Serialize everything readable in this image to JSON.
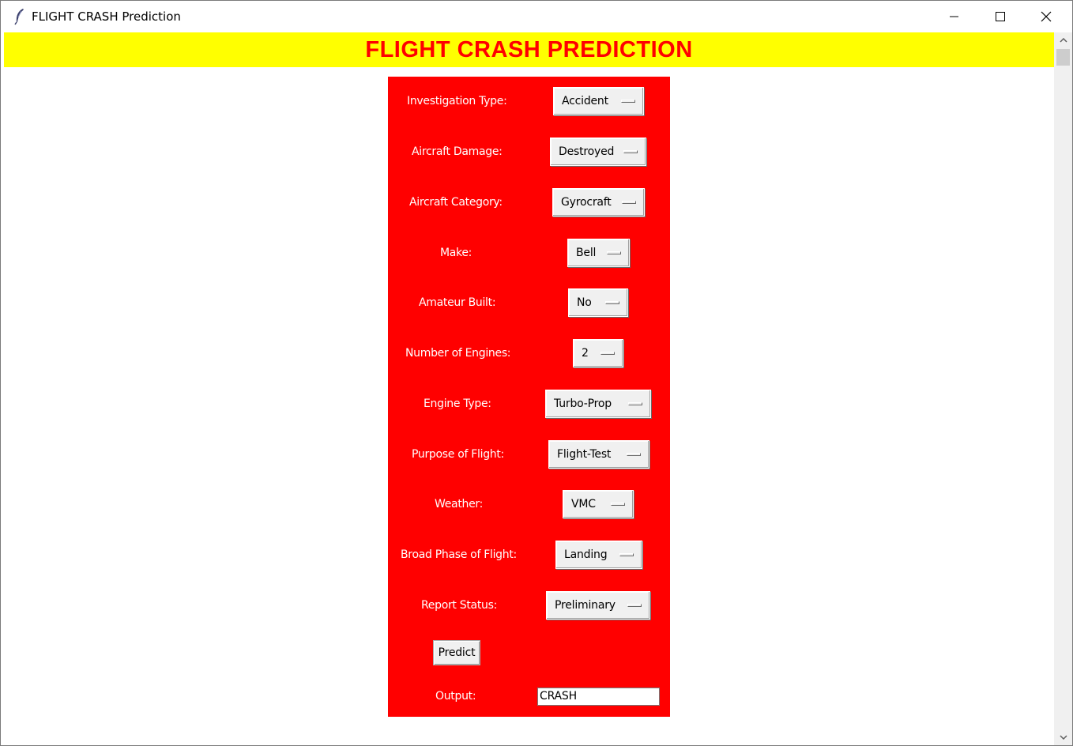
{
  "window": {
    "title": "FLIGHT CRASH Prediction"
  },
  "banner": {
    "title": "FLIGHT CRASH PREDICTION",
    "background_color": "#ffff00",
    "text_color": "#ff0000"
  },
  "panel": {
    "background_color": "#ff0000"
  },
  "fields": [
    {
      "label": "Investigation Type:",
      "value": "Accident"
    },
    {
      "label": "Aircraft Damage:",
      "value": "Destroyed"
    },
    {
      "label": "Aircraft Category:",
      "value": "Gyrocraft"
    },
    {
      "label": "Make:",
      "value": "Bell"
    },
    {
      "label": "Amateur Built:",
      "value": "No"
    },
    {
      "label": "Number of Engines:",
      "value": "2"
    },
    {
      "label": "Engine Type:",
      "value": "Turbo-Prop"
    },
    {
      "label": "Purpose of Flight:",
      "value": "Flight-Test"
    },
    {
      "label": "Weather:",
      "value": "VMC"
    },
    {
      "label": "Broad Phase of Flight:",
      "value": "Landing"
    },
    {
      "label": "Report Status:",
      "value": "Preliminary"
    }
  ],
  "predict_button": {
    "label": "Predict"
  },
  "output": {
    "label": "Output:",
    "value": "CRASH"
  },
  "icons": {
    "app": "feather-icon",
    "minimize": "minimize-icon",
    "maximize": "maximize-icon",
    "close": "close-icon"
  }
}
